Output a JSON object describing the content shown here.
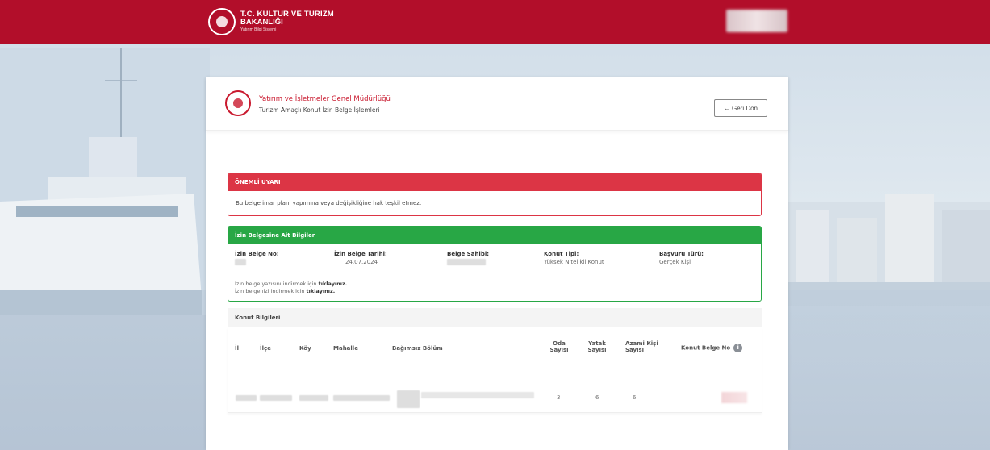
{
  "header": {
    "ministry_line1": "T.C. KÜLTÜR VE TURİZM",
    "ministry_line2": "BAKANLIĞI",
    "ministry_line3": "Yatırım Bilgi Sistemi",
    "brand_color": "#b20e2a"
  },
  "card": {
    "org_name": "Yatırım ve İşletmeler Genel Müdürlüğü",
    "org_sub": "Turizm Amaçlı Konut İzin Belge İşlemleri",
    "back_label": "Geri Dön",
    "back_icon": "arrow-left-icon"
  },
  "warning": {
    "title": "ÖNEMLİ UYARI",
    "text": "Bu belge imar planı yapımına veya değişikliğine hak teşkil etmez.",
    "color": "#dc3545"
  },
  "permit": {
    "title": "İzin Belgesine Ait Bilgiler",
    "color": "#28a745",
    "fields": {
      "no_label": "İzin Belge No:",
      "date_label": "İzin Belge Tarihi:",
      "date_value": "24.07.2024",
      "owner_label": "Belge Sahibi:",
      "type_label": "Konut Tipi:",
      "type_value": "Yüksek Nitelikli Konut",
      "app_label": "Başvuru Türü:",
      "app_value": "Gerçek Kişi"
    },
    "link1_prefix": "İzin belge yazısını indirmek için ",
    "link1_action": "tıklayınız.",
    "link2_prefix": "İzin belgenizi indirmek için ",
    "link2_action": "tıklayınız."
  },
  "housing": {
    "title": "Konut Bilgileri",
    "columns": {
      "il": "İl",
      "ilce": "İlçe",
      "koy": "Köy",
      "mahalle": "Mahalle",
      "bolum": "Bağımsız Bölüm",
      "oda_1": "Oda",
      "oda_2": "Sayısı",
      "yatak_1": "Yatak",
      "yatak_2": "Sayısı",
      "azami_1": "Azami Kişi",
      "azami_2": "Sayısı",
      "belge_no": "Konut Belge No"
    },
    "row": {
      "oda": "3",
      "yatak": "6",
      "azami": "6"
    }
  }
}
